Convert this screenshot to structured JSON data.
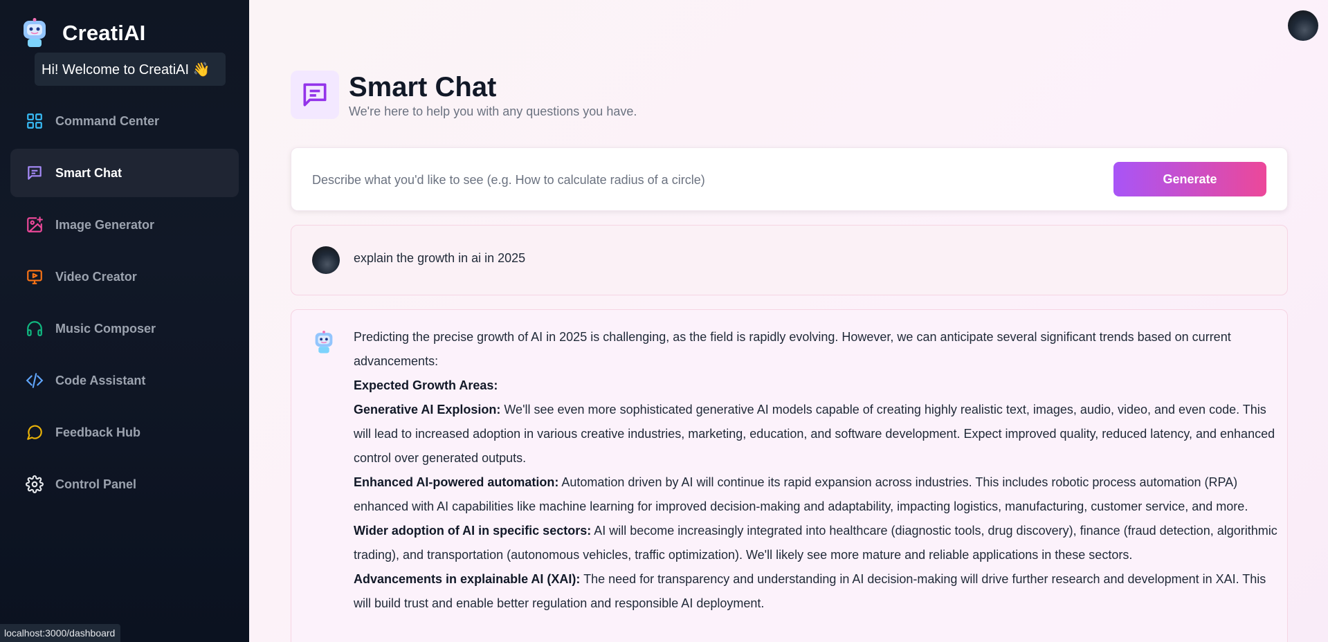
{
  "sidebar": {
    "brand": "CreatiAI",
    "welcome": "Hi! Welcome to CreatiAI 👋",
    "items": [
      {
        "label": "Command Center",
        "icon": "grid-icon",
        "color": "#38bdf8"
      },
      {
        "label": "Smart Chat",
        "icon": "chat-icon",
        "color": "#a78bfa"
      },
      {
        "label": "Image Generator",
        "icon": "image-plus-icon",
        "color": "#ec4899"
      },
      {
        "label": "Video Creator",
        "icon": "video-icon",
        "color": "#f97316"
      },
      {
        "label": "Music Composer",
        "icon": "headphones-icon",
        "color": "#10b981"
      },
      {
        "label": "Code Assistant",
        "icon": "code-icon",
        "color": "#60a5fa"
      },
      {
        "label": "Feedback Hub",
        "icon": "message-circle-icon",
        "color": "#eab308"
      },
      {
        "label": "Control Panel",
        "icon": "gear-icon",
        "color": "#e5e7eb"
      }
    ],
    "active_index": 1
  },
  "status_bar": {
    "url": "localhost:3000/dashboard"
  },
  "header": {
    "title": "Smart Chat",
    "subtitle": "We're here to help you with any questions you have."
  },
  "prompt": {
    "placeholder": "Describe what you'd like to see (e.g. How to calculate radius of a circle)",
    "value": "",
    "button_label": "Generate"
  },
  "conversation": {
    "user_message": "explain the growth in ai in 2025",
    "bot_intro": "Predicting the precise growth of AI in 2025 is challenging, as the field is rapidly evolving. However, we can anticipate several significant trends based on current advancements:",
    "bot_heading": "Expected Growth Areas:",
    "points": [
      {
        "title": "Generative AI Explosion:",
        "text": " We'll see even more sophisticated generative AI models capable of creating highly realistic text, images, audio, video, and even code. This will lead to increased adoption in various creative industries, marketing, education, and software development. Expect improved quality, reduced latency, and enhanced control over generated outputs."
      },
      {
        "title": "Enhanced AI-powered automation:",
        "text": " Automation driven by AI will continue its rapid expansion across industries. This includes robotic process automation (RPA) enhanced with AI capabilities like machine learning for improved decision-making and adaptability, impacting logistics, manufacturing, customer service, and more."
      },
      {
        "title": "Wider adoption of AI in specific sectors:",
        "text": " AI will become increasingly integrated into healthcare (diagnostic tools, drug discovery), finance (fraud detection, algorithmic trading), and transportation (autonomous vehicles, traffic optimization). We'll likely see more mature and reliable applications in these sectors."
      },
      {
        "title": "Advancements in explainable AI (XAI):",
        "text": " The need for transparency and understanding in AI decision-making will drive further research and development in XAI. This will build trust and enable better regulation and responsible AI deployment."
      }
    ]
  }
}
